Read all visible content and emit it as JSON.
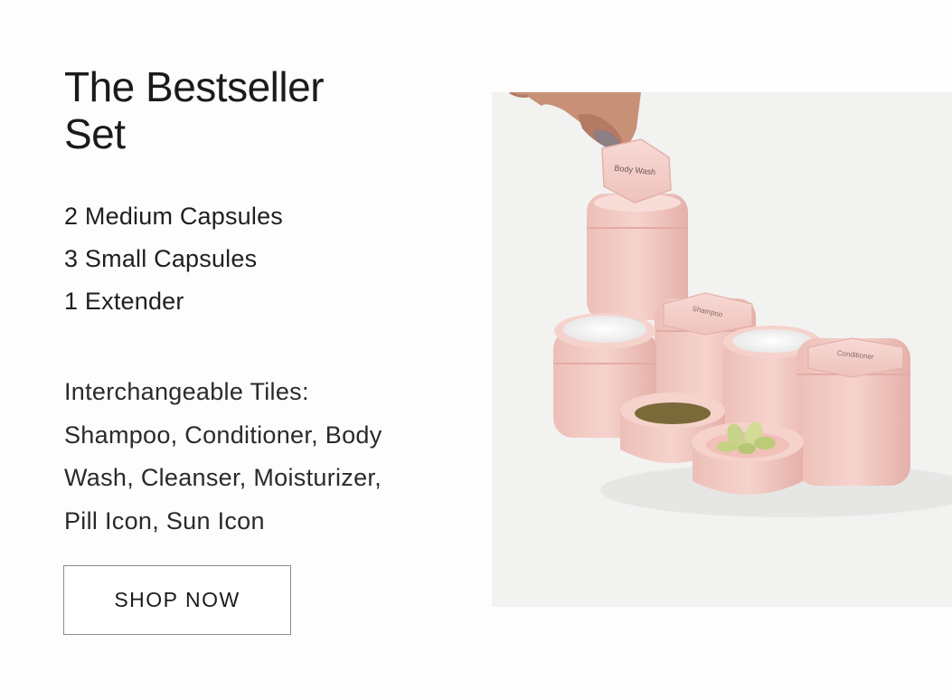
{
  "product": {
    "title_line1": "The Bestseller",
    "title_line2": "Set",
    "contents": [
      "2 Medium Capsules",
      "3 Small Capsules",
      "1 Extender"
    ],
    "tiles_heading": "Interchangeable Tiles:",
    "tiles_lines": [
      "Shampoo, Conditioner, Body",
      "Wash, Cleanser, Moisturizer,",
      "Pill Icon, Sun Icon"
    ]
  },
  "cta": {
    "label": "SHOP NOW"
  },
  "photo": {
    "tile_labels": {
      "body_wash": "Body Wash",
      "shampoo": "Shampoo",
      "conditioner": "Conditioner"
    },
    "colors": {
      "capsule": "#f2c9c3",
      "capsule_shade": "#e6b4ad",
      "background": "#f2f2f1"
    }
  }
}
